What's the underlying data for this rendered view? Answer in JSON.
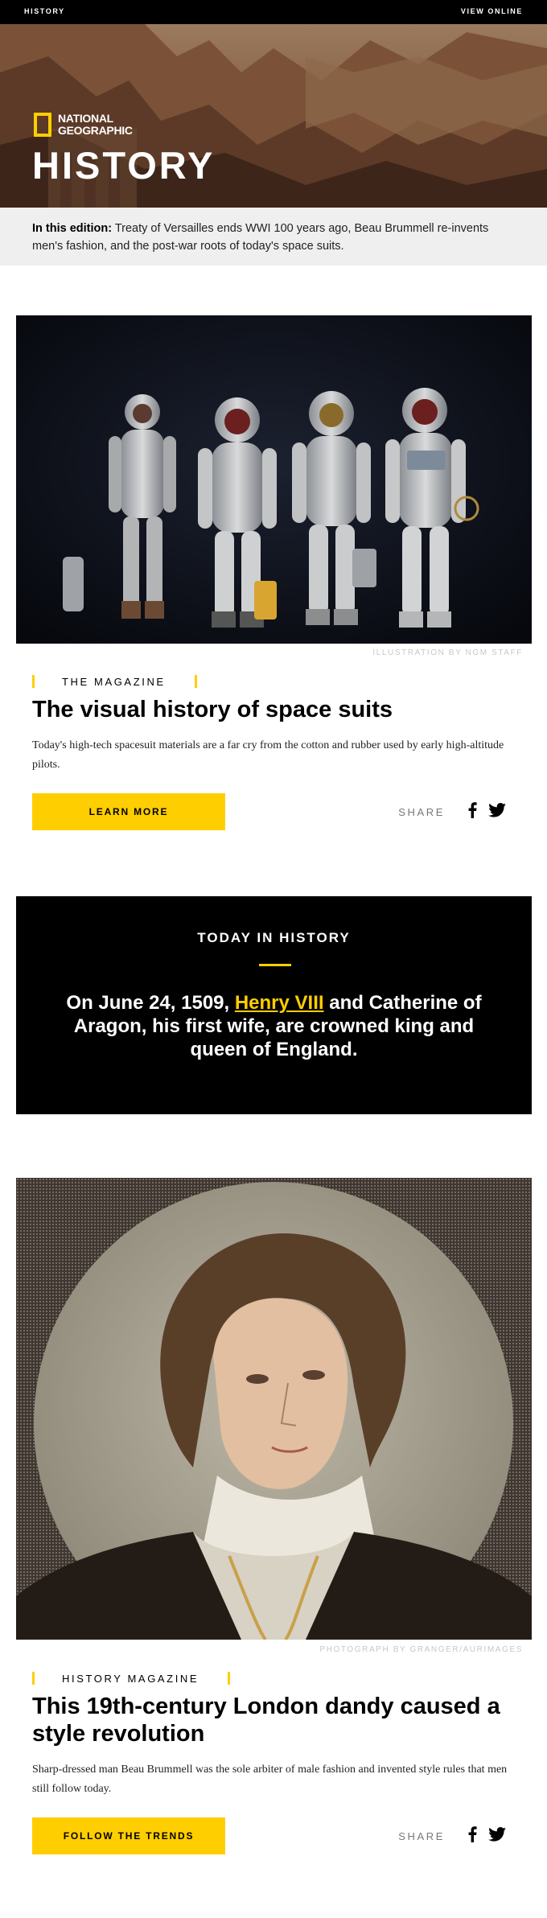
{
  "topbar": {
    "left": "HISTORY",
    "right": "VIEW ONLINE"
  },
  "hero": {
    "brand_line1": "NATIONAL",
    "brand_line2": "GEOGRAPHIC",
    "title": "HISTORY"
  },
  "edition": {
    "label": "In this edition:",
    "text": " Treaty of Versailles ends WWI 100 years ago, Beau Brummell re-invents men's fashion, and the post-war roots of today's space suits."
  },
  "story1": {
    "credit": "ILLUSTRATION BY NGM STAFF",
    "kicker": "THE MAGAZINE",
    "headline": "The visual history of space suits",
    "dek": "Today's high-tech spacesuit materials are a far cry from the cotton and rubber used by early high-altitude pilots.",
    "cta": "LEARN MORE",
    "share": "SHARE"
  },
  "today": {
    "heading": "TODAY IN HISTORY",
    "prefix": "On June 24, 1509, ",
    "highlight": "Henry VIII",
    "suffix": " and Catherine of Aragon, his first wife, are crowned king and queen of England."
  },
  "story2": {
    "credit": "PHOTOGRAPH BY GRANGER/AURIMAGES",
    "kicker": "HISTORY MAGAZINE",
    "headline": "This 19th-century London dandy caused a style revolution",
    "dek": "Sharp-dressed man Beau Brummell was the sole arbiter of male fashion and invented style rules that men still follow today.",
    "cta": "FOLLOW THE TRENDS",
    "share": "SHARE"
  },
  "icons": {
    "facebook": "facebook-icon",
    "twitter": "twitter-icon"
  },
  "colors": {
    "accent": "#ffce00",
    "black": "#000000",
    "edition_bg": "#efefef"
  }
}
